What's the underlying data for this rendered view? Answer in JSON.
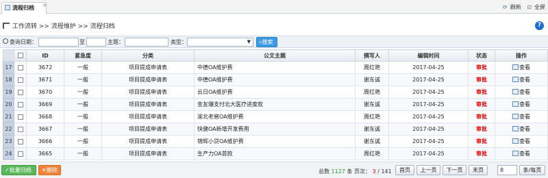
{
  "tab": {
    "title": "流程归档",
    "close": "×"
  },
  "top_actions": {
    "refresh": "刷新",
    "fullscreen": "全屏"
  },
  "breadcrumb": "工作流转 >> 流程维护 >> 流程归档",
  "search": {
    "date_label": "查询日期：",
    "to_label": "至",
    "subject_label": "主题：",
    "type_label": "类型：",
    "button": "搜索"
  },
  "table": {
    "headers": [
      "ID",
      "紧急度",
      "分类",
      "公文主题",
      "撰写人",
      "编辑时间",
      "状态",
      "操作"
    ],
    "rows": [
      {
        "rownum": "17",
        "id": "3672",
        "urgency": "一般",
        "category": "项目提成申请表",
        "subject": "中德OA维护费",
        "author": "周红艳",
        "time": "2017-04-25",
        "status": "审批",
        "action": "查看"
      },
      {
        "rownum": "18",
        "id": "3671",
        "urgency": "一般",
        "category": "项目提成申请表",
        "subject": "中德OA维护费",
        "author": "谢东诚",
        "time": "2017-04-25",
        "status": "审批",
        "action": "查看"
      },
      {
        "rownum": "19",
        "id": "3670",
        "urgency": "一般",
        "category": "项目提成申请表",
        "subject": "云日OA维护费",
        "author": "周红艳",
        "time": "2017-04-25",
        "status": "审批",
        "action": "查看"
      },
      {
        "rownum": "20",
        "id": "3669",
        "urgency": "一般",
        "category": "项目提成申请表",
        "subject": "金友爆支付北大医疗进度款",
        "author": "谢东诚",
        "time": "2017-04-25",
        "status": "审批",
        "action": "查看"
      },
      {
        "rownum": "21",
        "id": "3668",
        "urgency": "一般",
        "category": "项目提成申请表",
        "subject": "渝北老窖OA维护费",
        "author": "周红艳",
        "time": "2017-04-25",
        "status": "审批",
        "action": "查看"
      },
      {
        "rownum": "22",
        "id": "3667",
        "urgency": "一般",
        "category": "项目提成申请表",
        "subject": "快健OA新增开发费用",
        "author": "谢东诚",
        "time": "2017-04-25",
        "status": "审批",
        "action": "查看"
      },
      {
        "rownum": "23",
        "id": "3666",
        "urgency": "一般",
        "category": "项目提成申请表",
        "subject": "锦辉小贷OA维护费",
        "author": "谢东诚",
        "time": "2017-04-25",
        "status": "审批",
        "action": "查看"
      },
      {
        "rownum": "24",
        "id": "3665",
        "urgency": "一般",
        "category": "项目提成申请表",
        "subject": "生产力OA首款",
        "author": "周红艳",
        "time": "2017-04-25",
        "status": "审批",
        "action": "查看"
      }
    ]
  },
  "bottom": {
    "batch_archive": "批量归档",
    "delete": "删除",
    "total_label": "总数",
    "total": "1127",
    "total_unit": "条 页次：",
    "page_current": "3",
    "page_sep": "/",
    "page_total": "141",
    "first": "首页",
    "prev": "上一页",
    "next": "下一页",
    "last": "末页",
    "per_page_value": "8",
    "per_page_label": "条/每页"
  }
}
